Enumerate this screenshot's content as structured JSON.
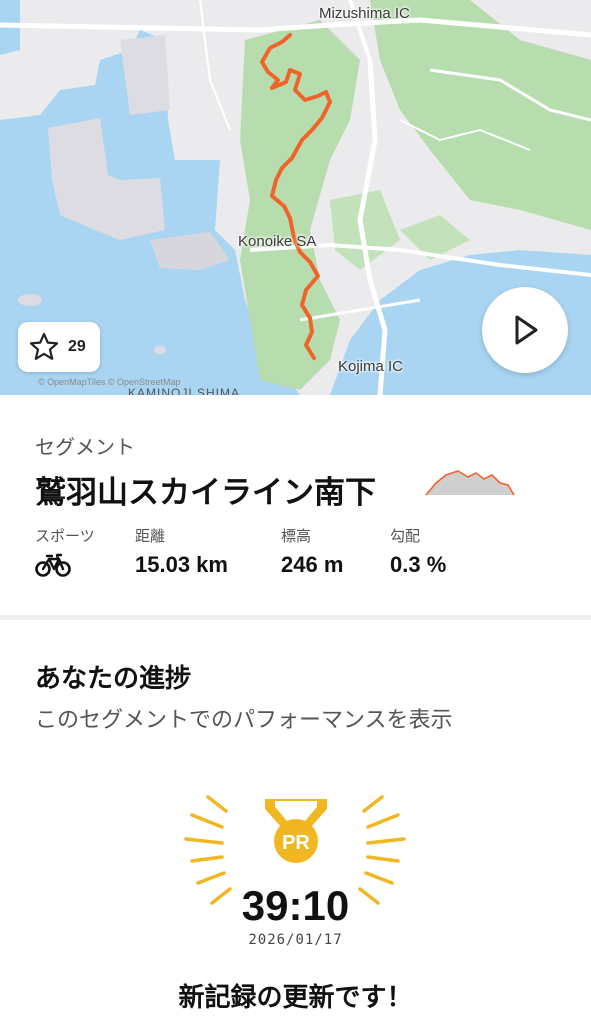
{
  "map": {
    "labels": {
      "mizushima_ic": "Mizushima IC",
      "konoike_sa": "Konoike SA",
      "kojima_ic": "Kojima IC",
      "island": "KAMINOJI SHIMA"
    },
    "attribution": "© OpenMapTiles © OpenStreetMap",
    "star_count": "29",
    "route_color": "#f0642a",
    "water_color": "#a9d5f2",
    "forest_color": "#b7dcae"
  },
  "segment": {
    "kicker": "セグメント",
    "title": "鷲羽山スカイライン南下",
    "stats": [
      {
        "label": "スポーツ",
        "value": "",
        "icon": "bicycle-icon"
      },
      {
        "label": "距離",
        "value": "15.03 km"
      },
      {
        "label": "標高",
        "value": "246 m"
      },
      {
        "label": "勾配",
        "value": "0.3 %"
      }
    ]
  },
  "progress": {
    "title": "あなたの進捗",
    "subtitle": "このセグメントでのパフォーマンスを表示",
    "medal_label": "PR",
    "medal_color": "#f1b722",
    "time": "39:10",
    "date": "2026/01/17",
    "message": "新記録の更新です！"
  }
}
